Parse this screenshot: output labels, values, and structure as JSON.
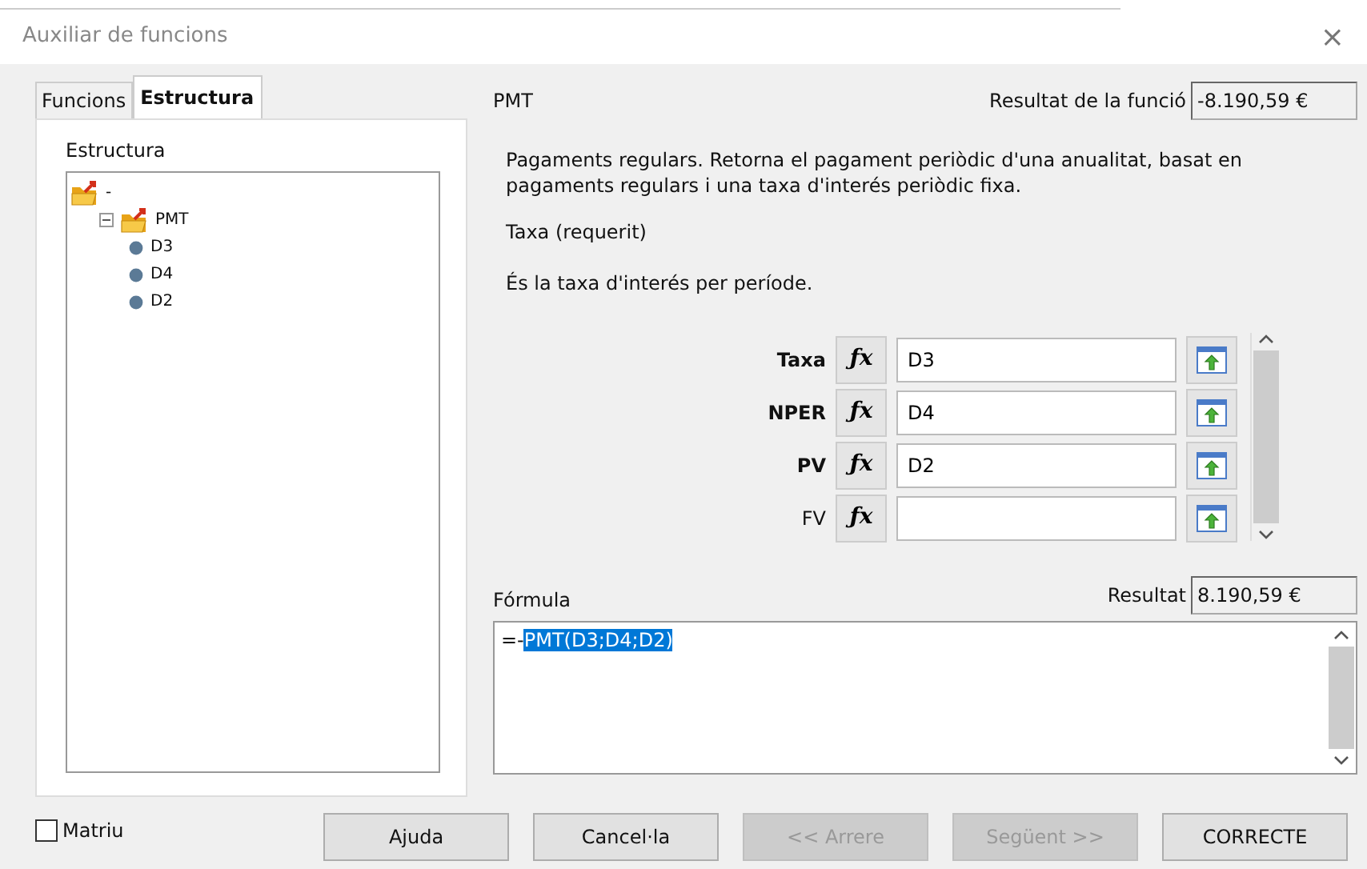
{
  "window": {
    "title": "Auxiliar de funcions",
    "close": "×"
  },
  "tabs": [
    {
      "label": "Funcions",
      "selected": false
    },
    {
      "label": "Estructura",
      "selected": true
    }
  ],
  "structure": {
    "label": "Estructura",
    "tree": [
      {
        "label": "-",
        "children": [
          {
            "label": "PMT",
            "expanded": true,
            "children": [
              {
                "label": "D3"
              },
              {
                "label": "D4"
              },
              {
                "label": "D2"
              }
            ]
          }
        ]
      }
    ]
  },
  "function": {
    "name": "PMT",
    "result_label": "Resultat de la funció",
    "result": "-8.190,59 €",
    "description": "Pagaments regulars. Retorna el pagament periòdic d'una anualitat, basat en pagaments regulars i una taxa d'interés periòdic fixa.",
    "argument_title": "Taxa (requerit)",
    "argument_description": "És la taxa d'interés per període."
  },
  "arguments": [
    {
      "label": "Taxa",
      "required": true,
      "fx": "ƒx",
      "value": "D3"
    },
    {
      "label": "NPER",
      "required": true,
      "fx": "ƒx",
      "value": "D4"
    },
    {
      "label": "PV",
      "required": true,
      "fx": "ƒx",
      "value": "D2"
    },
    {
      "label": "FV",
      "required": false,
      "fx": "ƒx"
    }
  ],
  "formula": {
    "label": "Fórmula",
    "result_label": "Resultat",
    "result": "8.190,59 €",
    "text": "=-",
    "selection": "PMT(D3;D4;D2)"
  },
  "array_checkbox": {
    "label": "Matriu",
    "checked": false
  },
  "buttons": [
    {
      "label": "Ajuda",
      "disabled": false
    },
    {
      "label": "Cancel·la",
      "disabled": false
    },
    {
      "label": "<< Arrere",
      "disabled": true
    },
    {
      "label": "Següent >>",
      "disabled": true
    },
    {
      "label": "CORRECTE",
      "disabled": false
    }
  ]
}
